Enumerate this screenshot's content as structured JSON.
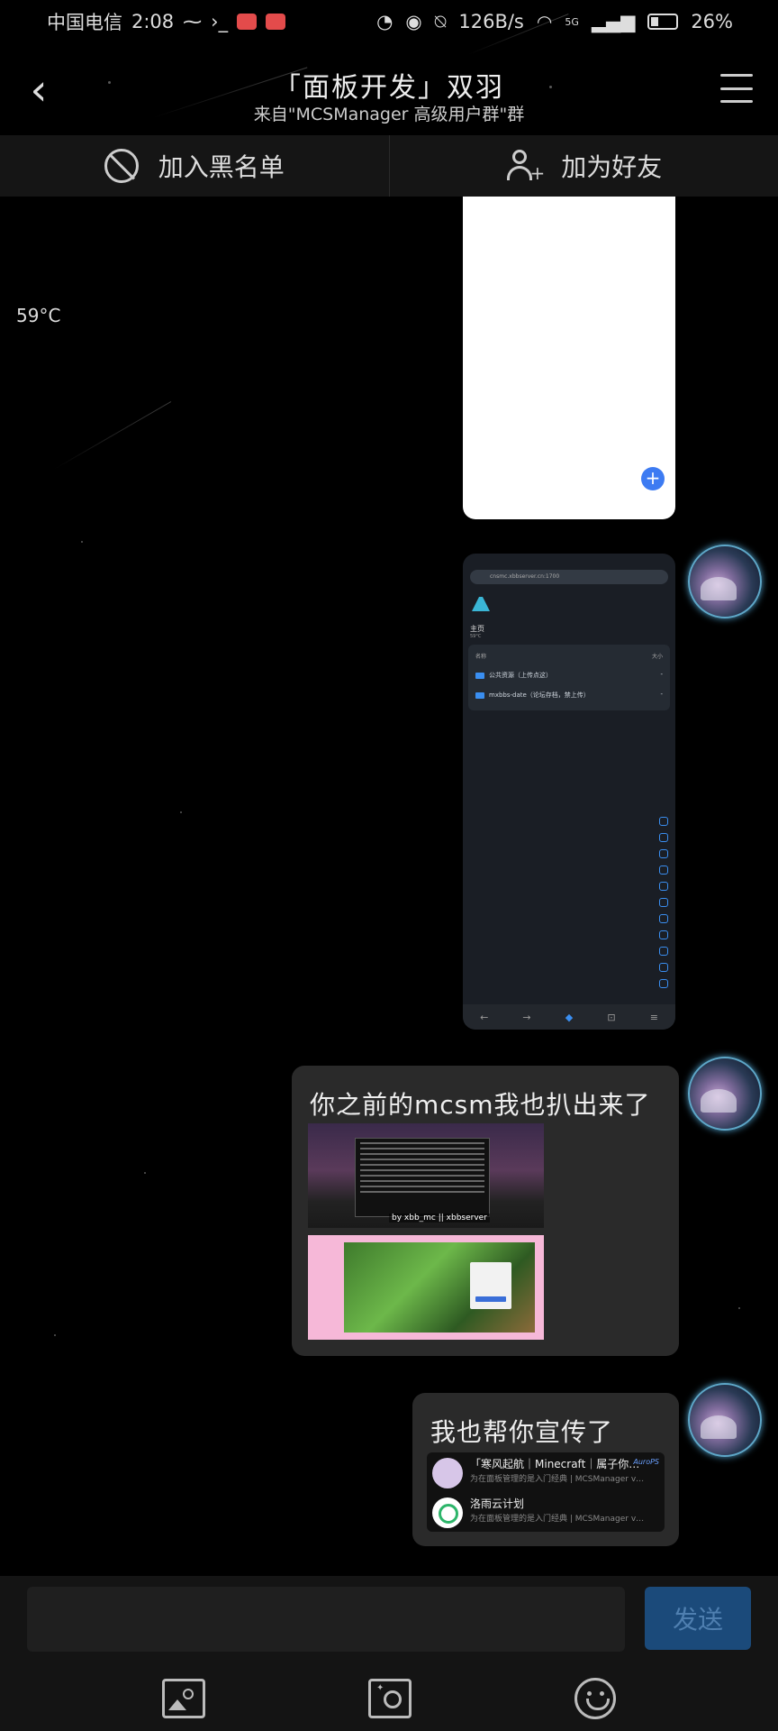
{
  "status_bar": {
    "carrier": "中国电信",
    "time": "2:08",
    "network_speed": "126B/s",
    "signal": "5G",
    "battery": "26%"
  },
  "header": {
    "title": "「面板开发」双羽",
    "subtitle": "来自\"MCSManager 高级用户群\"群"
  },
  "actions": {
    "blacklist_label": "加入黑名单",
    "add_friend_label": "加为好友"
  },
  "floating_temp": "59°C",
  "messages": {
    "screenshot": {
      "url": "cnsmc.xbbserver.cn:1700",
      "home_label": "主页",
      "home_sub": "59°C",
      "col_name": "名称",
      "col_size": "大小",
      "rows": [
        {
          "name": "公共资源（上传点这）",
          "size": "-"
        },
        {
          "name": "mxbbs-date（论坛存档，禁上传）",
          "size": "-"
        }
      ]
    },
    "bubble1_text": "你之前的mcsm我也扒出来了",
    "bubble1_caption": "by xbb_mc || xbbserver",
    "bubble2_text": "我也帮你宣传了",
    "cards": [
      {
        "title": "「寒风起航｜Minecraft｜属子你…",
        "badge": "AuroPS",
        "desc": "为在面板管理的是入门经典 | MCSManager v…"
      },
      {
        "title": "洛雨云计划",
        "desc": "为在面板管理的是入门经典 | MCSManager v…"
      }
    ]
  },
  "composer": {
    "placeholder": "",
    "send_label": "发送"
  },
  "colors": {
    "background": "#000000",
    "bubble": "#2a2a2a",
    "send_button": "#1b4a7a",
    "accent": "#3d7bf2"
  }
}
